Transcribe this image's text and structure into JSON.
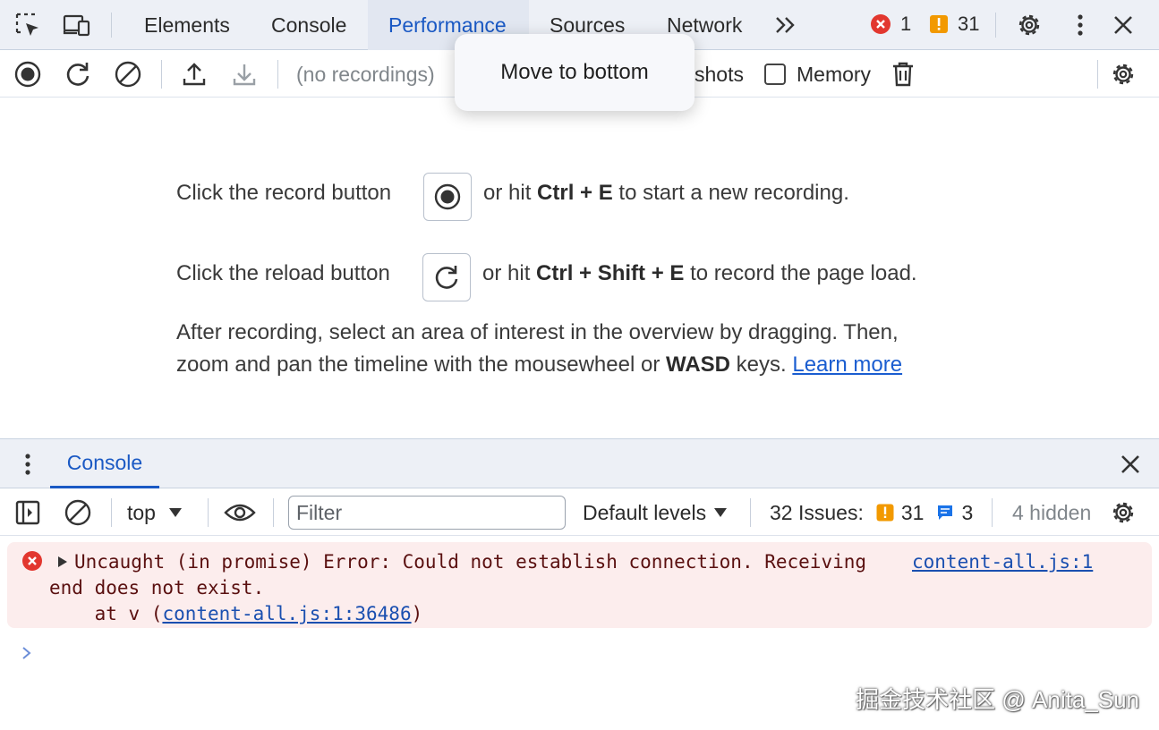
{
  "tabbar": {
    "tabs": [
      {
        "label": "Elements"
      },
      {
        "label": "Console"
      },
      {
        "label": "Performance"
      },
      {
        "label": "Sources"
      },
      {
        "label": "Network"
      }
    ],
    "active_tab": "Performance",
    "errors_count": "1",
    "warnings_count": "31"
  },
  "perf_toolbar": {
    "recordings_placeholder": "(no recordings)",
    "screenshots_label": "shots",
    "memory_label": "Memory"
  },
  "context_menu": {
    "item": "Move to bottom"
  },
  "landing": {
    "record_line_prefix": "Click the record button",
    "record_line_or_hit": "or hit",
    "record_shortcut": "Ctrl + E",
    "record_line_suffix": "to start a new recording.",
    "reload_line_prefix": "Click the reload button",
    "reload_line_or_hit": "or hit",
    "reload_shortcut": "Ctrl + Shift + E",
    "reload_line_suffix": "to record the page load.",
    "after_line_1": "After recording, select an area of interest in the overview by dragging. Then,",
    "after_line_2_prefix": "zoom and pan the timeline with the mousewheel or",
    "after_line_2_keys": "WASD",
    "after_line_2_suffix": "keys.",
    "learn_more": "Learn more"
  },
  "drawer": {
    "tab_label": "Console"
  },
  "console_toolbar": {
    "context": "top",
    "filter_placeholder": "Filter",
    "levels": "Default levels",
    "issues_label": "32 Issues:",
    "issues_warnings": "31",
    "issues_info": "3",
    "hidden": "4 hidden"
  },
  "console_messages": [
    {
      "line1": "Uncaught (in promise) Error: Could not establish connection. Receiving",
      "line2": "end does not exist.",
      "stack_prefix": "    at v (",
      "stack_link": "content-all.js:1:36486",
      "stack_suffix": ")",
      "source_link": "content-all.js:1"
    }
  ],
  "watermark": "掘金技术社区 @ Anita_Sun",
  "colors": {
    "accent": "#1a59c4",
    "error": "#e2372f",
    "warning": "#f29900",
    "info": "#1a73e8",
    "error_bg": "#fceded"
  }
}
